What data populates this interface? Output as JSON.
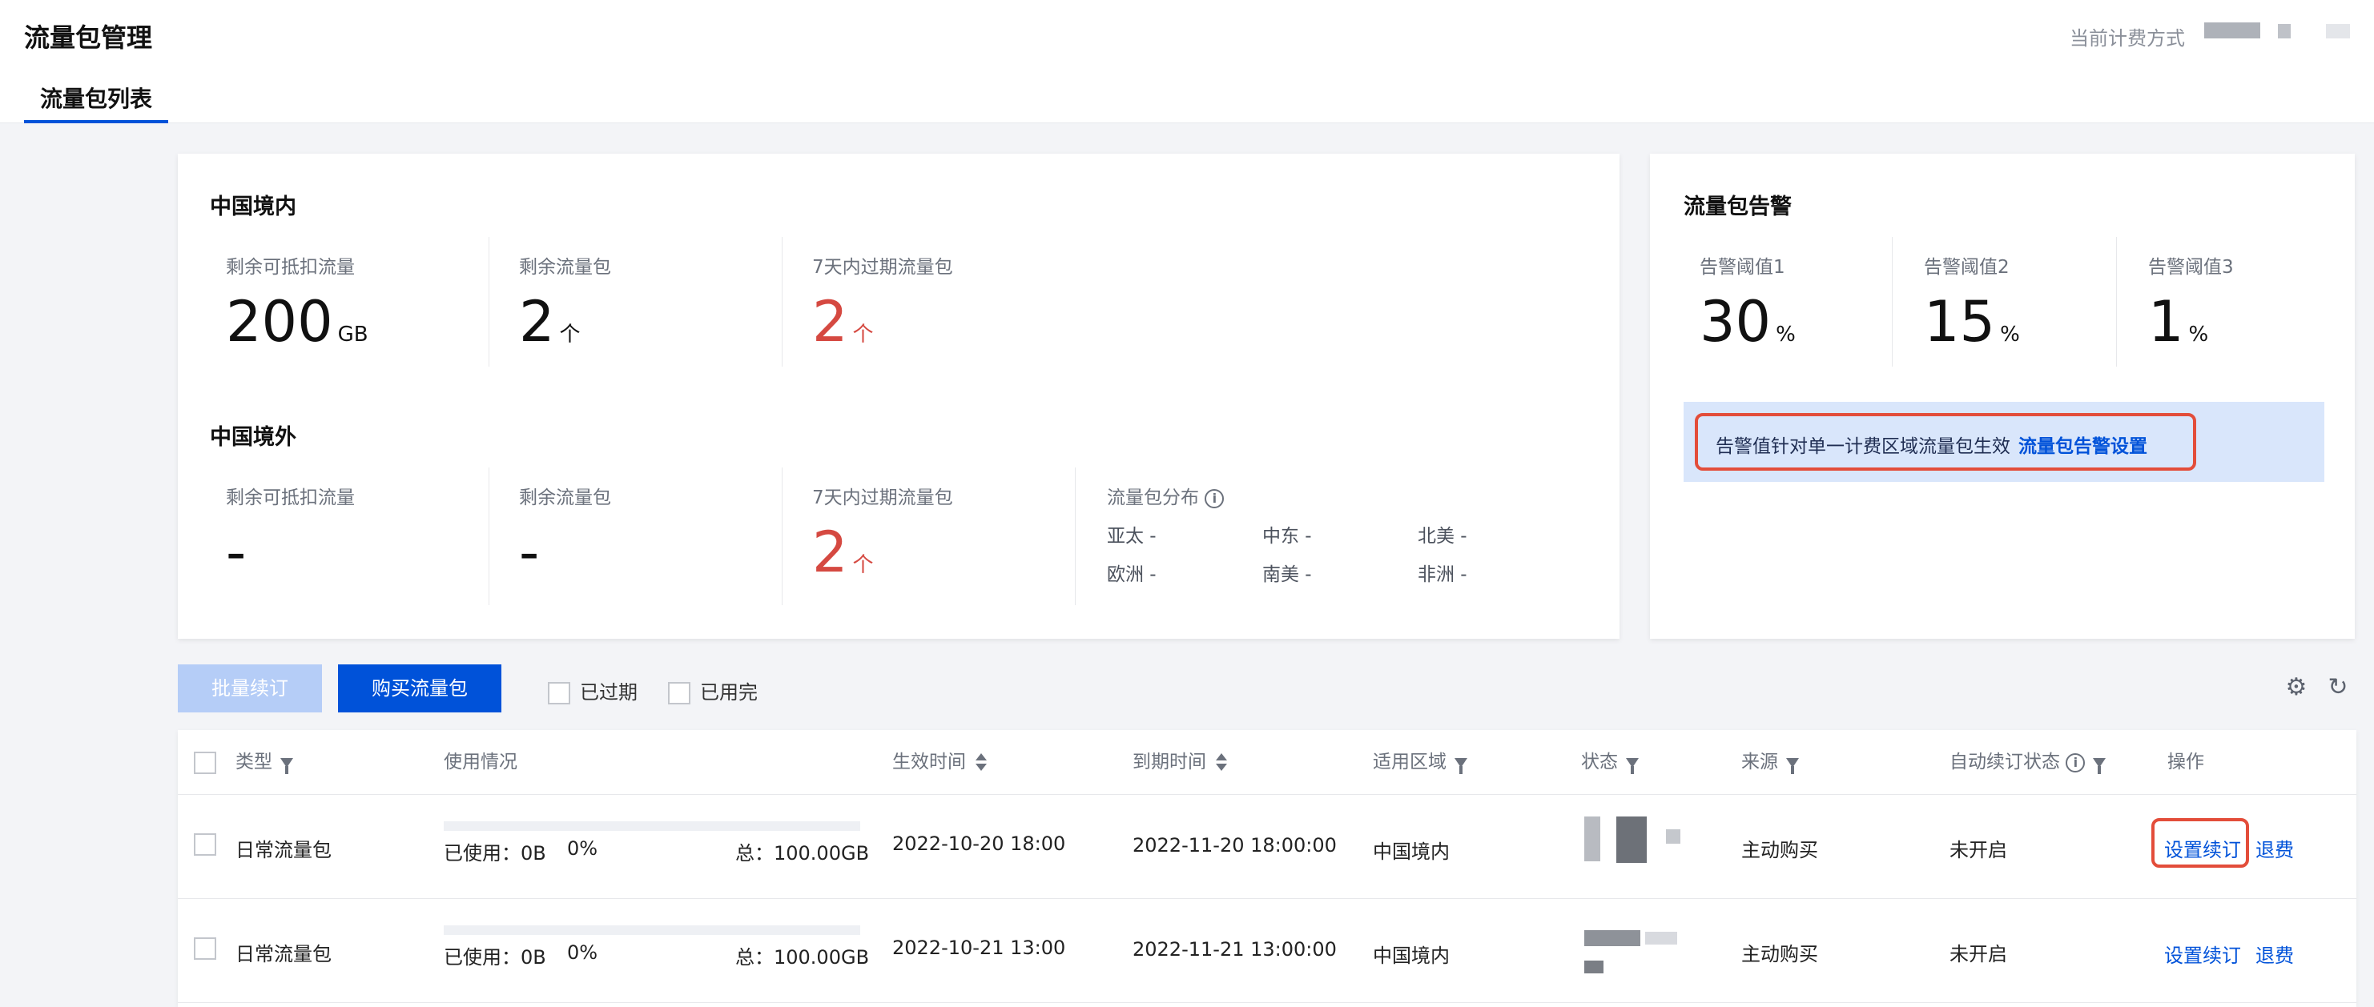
{
  "header": {
    "title": "流量包管理",
    "billing_label": "当前计费方式",
    "tab_label": "流量包列表"
  },
  "domestic": {
    "title": "中国境内",
    "stats": [
      {
        "label": "剩余可抵扣流量",
        "value": "200",
        "unit": "GB"
      },
      {
        "label": "剩余流量包",
        "value": "2",
        "unit": "个"
      },
      {
        "label": "7天内过期流量包",
        "value": "2",
        "unit": "个"
      }
    ]
  },
  "overseas": {
    "title": "中国境外",
    "stats": [
      {
        "label": "剩余可抵扣流量",
        "value": "-"
      },
      {
        "label": "剩余流量包",
        "value": "-"
      },
      {
        "label": "7天内过期流量包",
        "value": "2",
        "unit": "个"
      }
    ],
    "distribution": {
      "label": "流量包分布",
      "regions": [
        "亚太 -",
        "中东 -",
        "北美 -",
        "欧洲 -",
        "南美 -",
        "非洲 -"
      ]
    }
  },
  "alarm": {
    "title": "流量包告警",
    "thresholds": [
      {
        "label": "告警阈值1",
        "value": "30",
        "unit": "%"
      },
      {
        "label": "告警阈值2",
        "value": "15",
        "unit": "%"
      },
      {
        "label": "告警阈值3",
        "value": "1",
        "unit": "%"
      }
    ],
    "note": "告警值针对单一计费区域流量包生效",
    "link": "流量包告警设置"
  },
  "toolbar": {
    "batch_renew": "批量续订",
    "buy": "购买流量包",
    "filter_expired": "已过期",
    "filter_used_up": "已用完"
  },
  "table": {
    "columns": [
      "类型",
      "使用情况",
      "生效时间",
      "到期时间",
      "适用区域",
      "状态",
      "来源",
      "自动续订状态",
      "操作"
    ],
    "rows": [
      {
        "type": "日常流量包",
        "used": "已使用：0B",
        "percent": "0%",
        "total": "总：100.00GB",
        "start": "2022-10-20 18:00",
        "end": "2022-11-20 18:00:00",
        "region": "中国境内",
        "source": "主动购买",
        "auto_renew": "未开启",
        "op_renew": "设置续订",
        "op_refund": "退费"
      },
      {
        "type": "日常流量包",
        "used": "已使用：0B",
        "percent": "0%",
        "total": "总：100.00GB",
        "start": "2022-10-21 13:00",
        "end": "2022-11-21 13:00:00",
        "region": "中国境内",
        "source": "主动购买",
        "auto_renew": "未开启",
        "op_renew": "设置续订",
        "op_refund": "退费"
      }
    ]
  },
  "colors": {
    "primary": "#0052d9",
    "danger": "#d54941",
    "highlight_border": "#e34d3a"
  }
}
